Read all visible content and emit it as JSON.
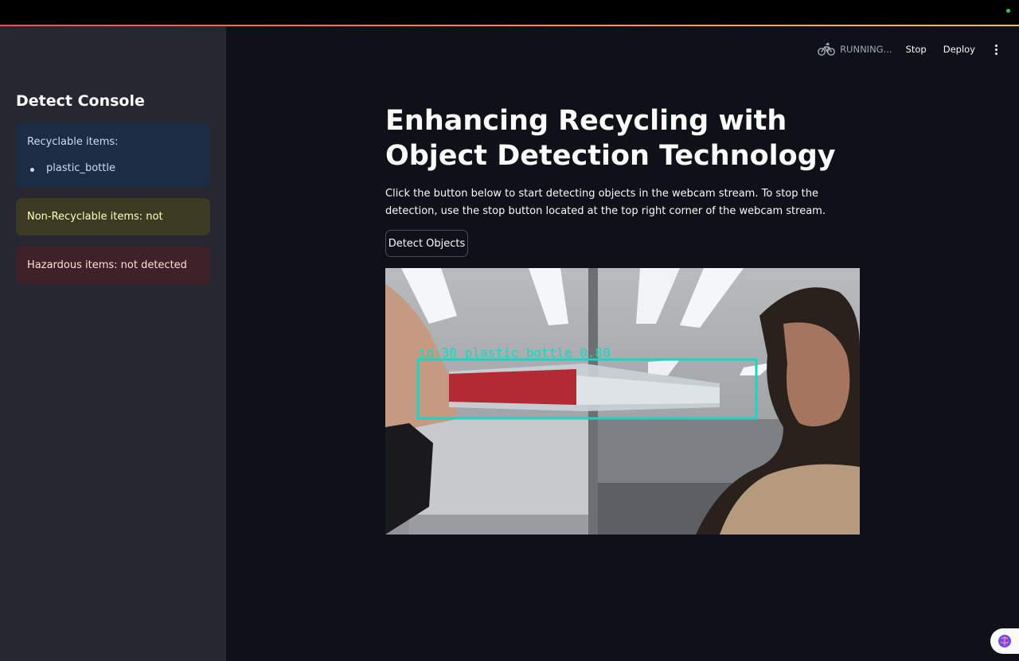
{
  "toolbar": {
    "status": "RUNNING...",
    "stop_label": "Stop",
    "deploy_label": "Deploy",
    "menu_icon": "vertical-ellipsis-icon",
    "status_icon": "bicycle-icon"
  },
  "sidebar": {
    "title": "Detect Console",
    "recyclable": {
      "label": "Recyclable items:",
      "items": [
        "plastic_bottle"
      ]
    },
    "non_recyclable": "Non-Recyclable items: not detected",
    "hazardous": "Hazardous items: not detected"
  },
  "main": {
    "title": "Enhancing Recycling with Object Detection Technology",
    "description": "Click the button below to start detecting objects in the webcam stream. To stop the detection, use the stop button located at the top right corner of the webcam stream.",
    "detect_button_label": "Detect Objects"
  },
  "webcam": {
    "detection_label": "id:30 plastic_bottle 0.80",
    "box_color": "#19d6c4"
  },
  "colors": {
    "accent_start": "#ff4b4b",
    "accent_end": "#ffbd45",
    "info_bg": "#1c2c45",
    "warning_bg": "#3d3a24",
    "error_bg": "#3e2228"
  }
}
